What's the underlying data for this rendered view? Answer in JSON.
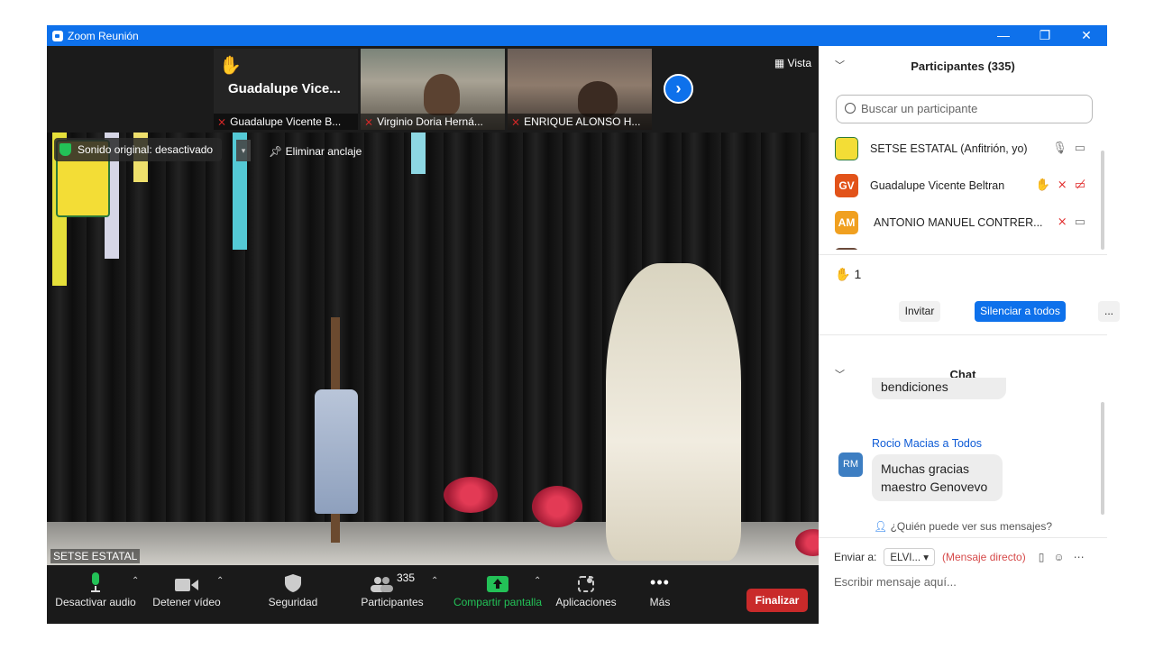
{
  "window": {
    "title": "Zoom Reunión",
    "controls": [
      "—",
      "❐",
      "✕"
    ]
  },
  "strip": {
    "tiles": [
      {
        "big_name": "Guadalupe  Vice...",
        "label": "Guadalupe Vicente B..."
      },
      {
        "label": "Virginio Doria Herná..."
      },
      {
        "label": "ENRIQUE ALONSO H..."
      }
    ],
    "next_icon": "›",
    "view_label": "Vista"
  },
  "stage": {
    "original_sound": "Sonido original: desactivado",
    "unpin_label": "Eliminar anclaje",
    "speaker_label": "SETSE ESTATAL"
  },
  "toolbar": {
    "audio": "Desactivar audio",
    "video": "Detener vídeo",
    "security": "Seguridad",
    "participants": "Participantes",
    "participants_count": "335",
    "share": "Compartir pantalla",
    "apps": "Aplicaciones",
    "more": "Más",
    "end": "Finalizar"
  },
  "participants": {
    "header": "Participantes (335)",
    "search_placeholder": "Buscar un participante",
    "list": [
      {
        "initials": "",
        "name": "SETSE ESTATAL (Anfitrión, yo)",
        "color": "#f3dd36"
      },
      {
        "initials": "GV",
        "name": "Guadalupe Vicente Beltran",
        "color": "#e2531a"
      },
      {
        "initials": "AM",
        "name": "ANTONIO MANUEL CONTRER...",
        "color": "#f0a020"
      }
    ],
    "raised_hands": "1",
    "invite": "Invitar",
    "mute_all": "Silenciar a todos",
    "more": "..."
  },
  "chat": {
    "header": "Chat",
    "prev_message": "bendiciones",
    "sender": "Rocio Macias a Todos",
    "sender_initials": "RM",
    "message_line1": "Muchas gracias",
    "message_line2": "maestro Genovevo",
    "who_can_see": "¿Quién puede ver sus mensajes?",
    "send_to_label": "Enviar a:",
    "send_to_value": "ELVI...",
    "direct": "(Mensaje directo)",
    "compose_placeholder": "Escribir mensaje aquí..."
  },
  "colors": {
    "zoom_blue": "#0e71eb",
    "end_red": "#c92a2a",
    "share_green": "#23c157"
  }
}
